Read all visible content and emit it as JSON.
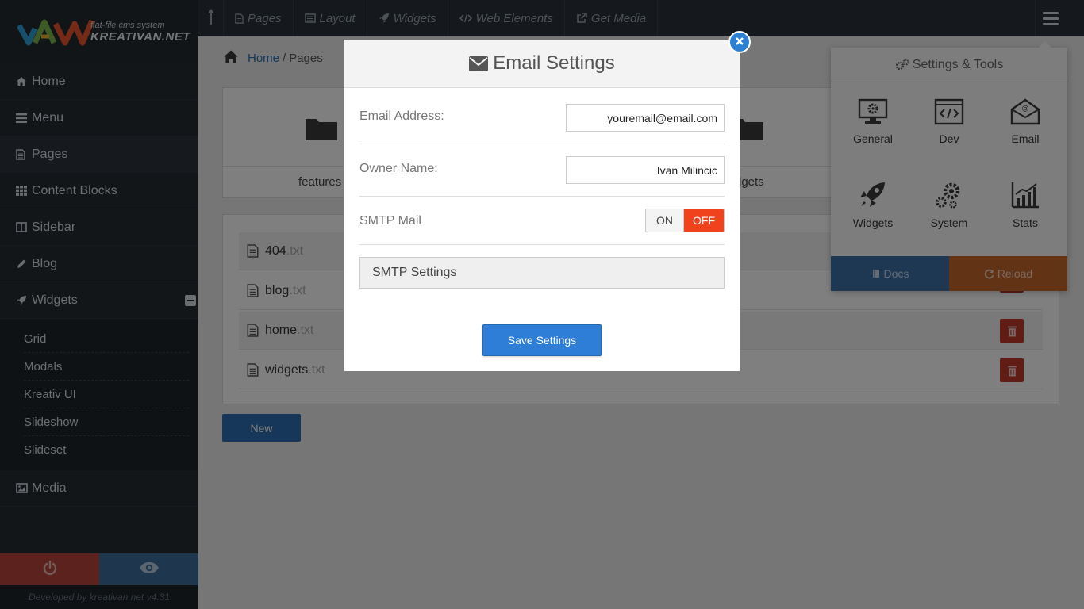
{
  "logo": {
    "subtitle": "flat-file cms system",
    "name": "KREATIVAN.NET"
  },
  "sidebar": {
    "items": [
      {
        "label": "Home",
        "icon": "home-icon"
      },
      {
        "label": "Menu",
        "icon": "bars-icon"
      },
      {
        "label": "Pages",
        "icon": "file-icon"
      },
      {
        "label": "Content Blocks",
        "icon": "grid-icon"
      },
      {
        "label": "Sidebar",
        "icon": "columns-icon"
      },
      {
        "label": "Blog",
        "icon": "pencil-icon"
      },
      {
        "label": "Widgets",
        "icon": "rocket-icon"
      }
    ],
    "widget_subitems": [
      "Grid",
      "Modals",
      "Kreativ UI",
      "Slideshow",
      "Slideset"
    ],
    "media_label": "Media",
    "footer": "Developed by kreativan.net v4.31"
  },
  "topbar": {
    "items": [
      {
        "label": "Pages",
        "icon": "file-icon"
      },
      {
        "label": "Layout",
        "icon": "layout-icon"
      },
      {
        "label": "Widgets",
        "icon": "rocket-icon"
      },
      {
        "label": "Web Elements",
        "icon": "code-icon"
      },
      {
        "label": "Get Media",
        "icon": "external-link-icon"
      }
    ]
  },
  "breadcrumb": {
    "home": "Home",
    "separator": "/",
    "current": "Pages"
  },
  "folders": {
    "first_label": "features",
    "last_label": "dgets"
  },
  "files": [
    {
      "name": "404",
      "ext": ".txt"
    },
    {
      "name": "blog",
      "ext": ".txt"
    },
    {
      "name": "home",
      "ext": ".txt"
    },
    {
      "name": "widgets",
      "ext": ".txt"
    }
  ],
  "new_button": "New",
  "tools": {
    "title": "Settings & Tools",
    "items": [
      {
        "label": "General",
        "icon": "monitor-gear-icon"
      },
      {
        "label": "Dev",
        "icon": "code-window-icon"
      },
      {
        "label": "Email",
        "icon": "envelope-open-icon"
      },
      {
        "label": "Widgets",
        "icon": "rocket-icon"
      },
      {
        "label": "System",
        "icon": "gears-icon"
      },
      {
        "label": "Stats",
        "icon": "chart-icon"
      }
    ],
    "docs": "Docs",
    "reload": "Reload"
  },
  "modal": {
    "title": "Email Settings",
    "email_label": "Email Address:",
    "email_value": "youremail@email.com",
    "owner_label": "Owner Name:",
    "owner_value": "Ivan Milincic",
    "smtp_label": "SMTP Mail",
    "toggle_on": "ON",
    "toggle_off": "OFF",
    "smtp_settings": "SMTP Settings",
    "save": "Save Settings"
  },
  "colors": {
    "accent_blue": "#2e7ed8",
    "off_red": "#f0421c",
    "sidebar_bg": "#252c33",
    "delete_red": "#c0392b",
    "reload_orange": "#c6662b"
  }
}
